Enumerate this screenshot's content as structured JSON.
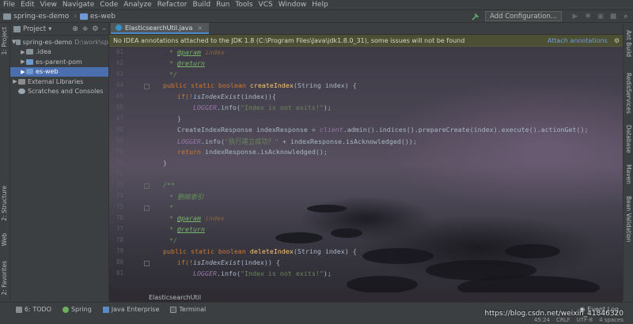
{
  "menu": [
    "File",
    "Edit",
    "View",
    "Navigate",
    "Code",
    "Analyze",
    "Refactor",
    "Build",
    "Run",
    "Tools",
    "VCS",
    "Window",
    "Help"
  ],
  "breadcrumb": {
    "project": "spring-es-demo",
    "module": "es-web"
  },
  "toolbar": {
    "config_label": "Add Configuration..."
  },
  "left_tabs": {
    "project": "1: Project",
    "structure": "2: Structure",
    "web": "Web",
    "favorites": "2: Favorites"
  },
  "right_tabs": {
    "ant": "Ant Build",
    "redis": "RedisServices",
    "database": "Database",
    "maven": "Maven",
    "bean": "Bean Validation"
  },
  "project_panel": {
    "title": "Project",
    "tree": [
      {
        "label": "spring-es-demo",
        "extra": "D:\\work\\sp",
        "indent": 0,
        "arrow": "▼",
        "selected": false
      },
      {
        "label": ".idea",
        "extra": "",
        "indent": 1,
        "arrow": "▶",
        "selected": false
      },
      {
        "label": "es-parent-pom",
        "extra": "",
        "indent": 1,
        "arrow": "▶",
        "selected": false
      },
      {
        "label": "es-web",
        "extra": "",
        "indent": 1,
        "arrow": "▶",
        "selected": true
      },
      {
        "label": "External Libraries",
        "extra": "",
        "indent": 0,
        "arrow": "▶",
        "selected": false
      },
      {
        "label": "Scratches and Consoles",
        "extra": "",
        "indent": 0,
        "arrow": "",
        "selected": false
      }
    ]
  },
  "editor": {
    "tab_label": "ElasticsearchUtil.java",
    "banner_text": "No IDEA annotations attached to the JDK 1.8 (C:\\Program Files\\Java\\jdk1.8.0_31), some issues will not be found",
    "banner_link": "Attach annotations",
    "line_numbers": [
      "61",
      "62",
      "63",
      "64",
      "65",
      "66",
      "67",
      "68",
      "69",
      "70",
      "71",
      "72",
      "73",
      "74",
      "75",
      "76",
      "77",
      "78",
      "79",
      "80",
      "81"
    ],
    "footer_crumb": "ElasticsearchUtil"
  },
  "code": {
    "l61a": "* ",
    "l61b": "@param",
    "l61c": " index",
    "l62a": "* ",
    "l62b": "@return",
    "l63": "*/",
    "l64a": "public static boolean ",
    "l64b": "createIndex",
    "l64c": "(String index) {",
    "l65a": "if(!",
    "l65b": "isIndexExist",
    "l65c": "(index)){",
    "l66a": "LOGGER",
    "l66b": ".info(",
    "l66c": "\"Index is not exits!\"",
    "l66d": ");",
    "l67": "}",
    "l68a": "CreateIndexResponse indexResponse = ",
    "l68b": "client",
    "l68c": ".admin().indices().prepareCreate(index).execute().actionGet();",
    "l69a": "LOGGER",
    "l69b": ".info(",
    "l69c": "\"执行建立成功？\"",
    "l69d": " + indexResponse.isAcknowledged());",
    "l70a": "return ",
    "l70b": "indexResponse.isAcknowledged();",
    "l71": "}",
    "l73": "/**",
    "l74": "* 删除索引",
    "l75": "*",
    "l76a": "* ",
    "l76b": "@param",
    "l76c": " index",
    "l77a": "* ",
    "l77b": "@return",
    "l78": "*/",
    "l79a": "public static boolean ",
    "l79b": "deleteIndex",
    "l79c": "(String index) {",
    "l80a": "if(!",
    "l80b": "isIndexExist",
    "l80c": "(index)) {",
    "l81a": "LOGGER",
    "l81b": ".info(",
    "l81c": "\"Index is not exits!\"",
    "l81d": ");"
  },
  "tool_windows": [
    "6: TODO",
    "Spring",
    "Java Enterprise",
    "Terminal"
  ],
  "event_log": "Event Log",
  "status": {
    "position": "45:24",
    "line_sep": "CRLF",
    "encoding": "UTF-8",
    "indent": "4 spaces"
  },
  "watermark": "https://blog.csdn.net/weixin_41846320"
}
